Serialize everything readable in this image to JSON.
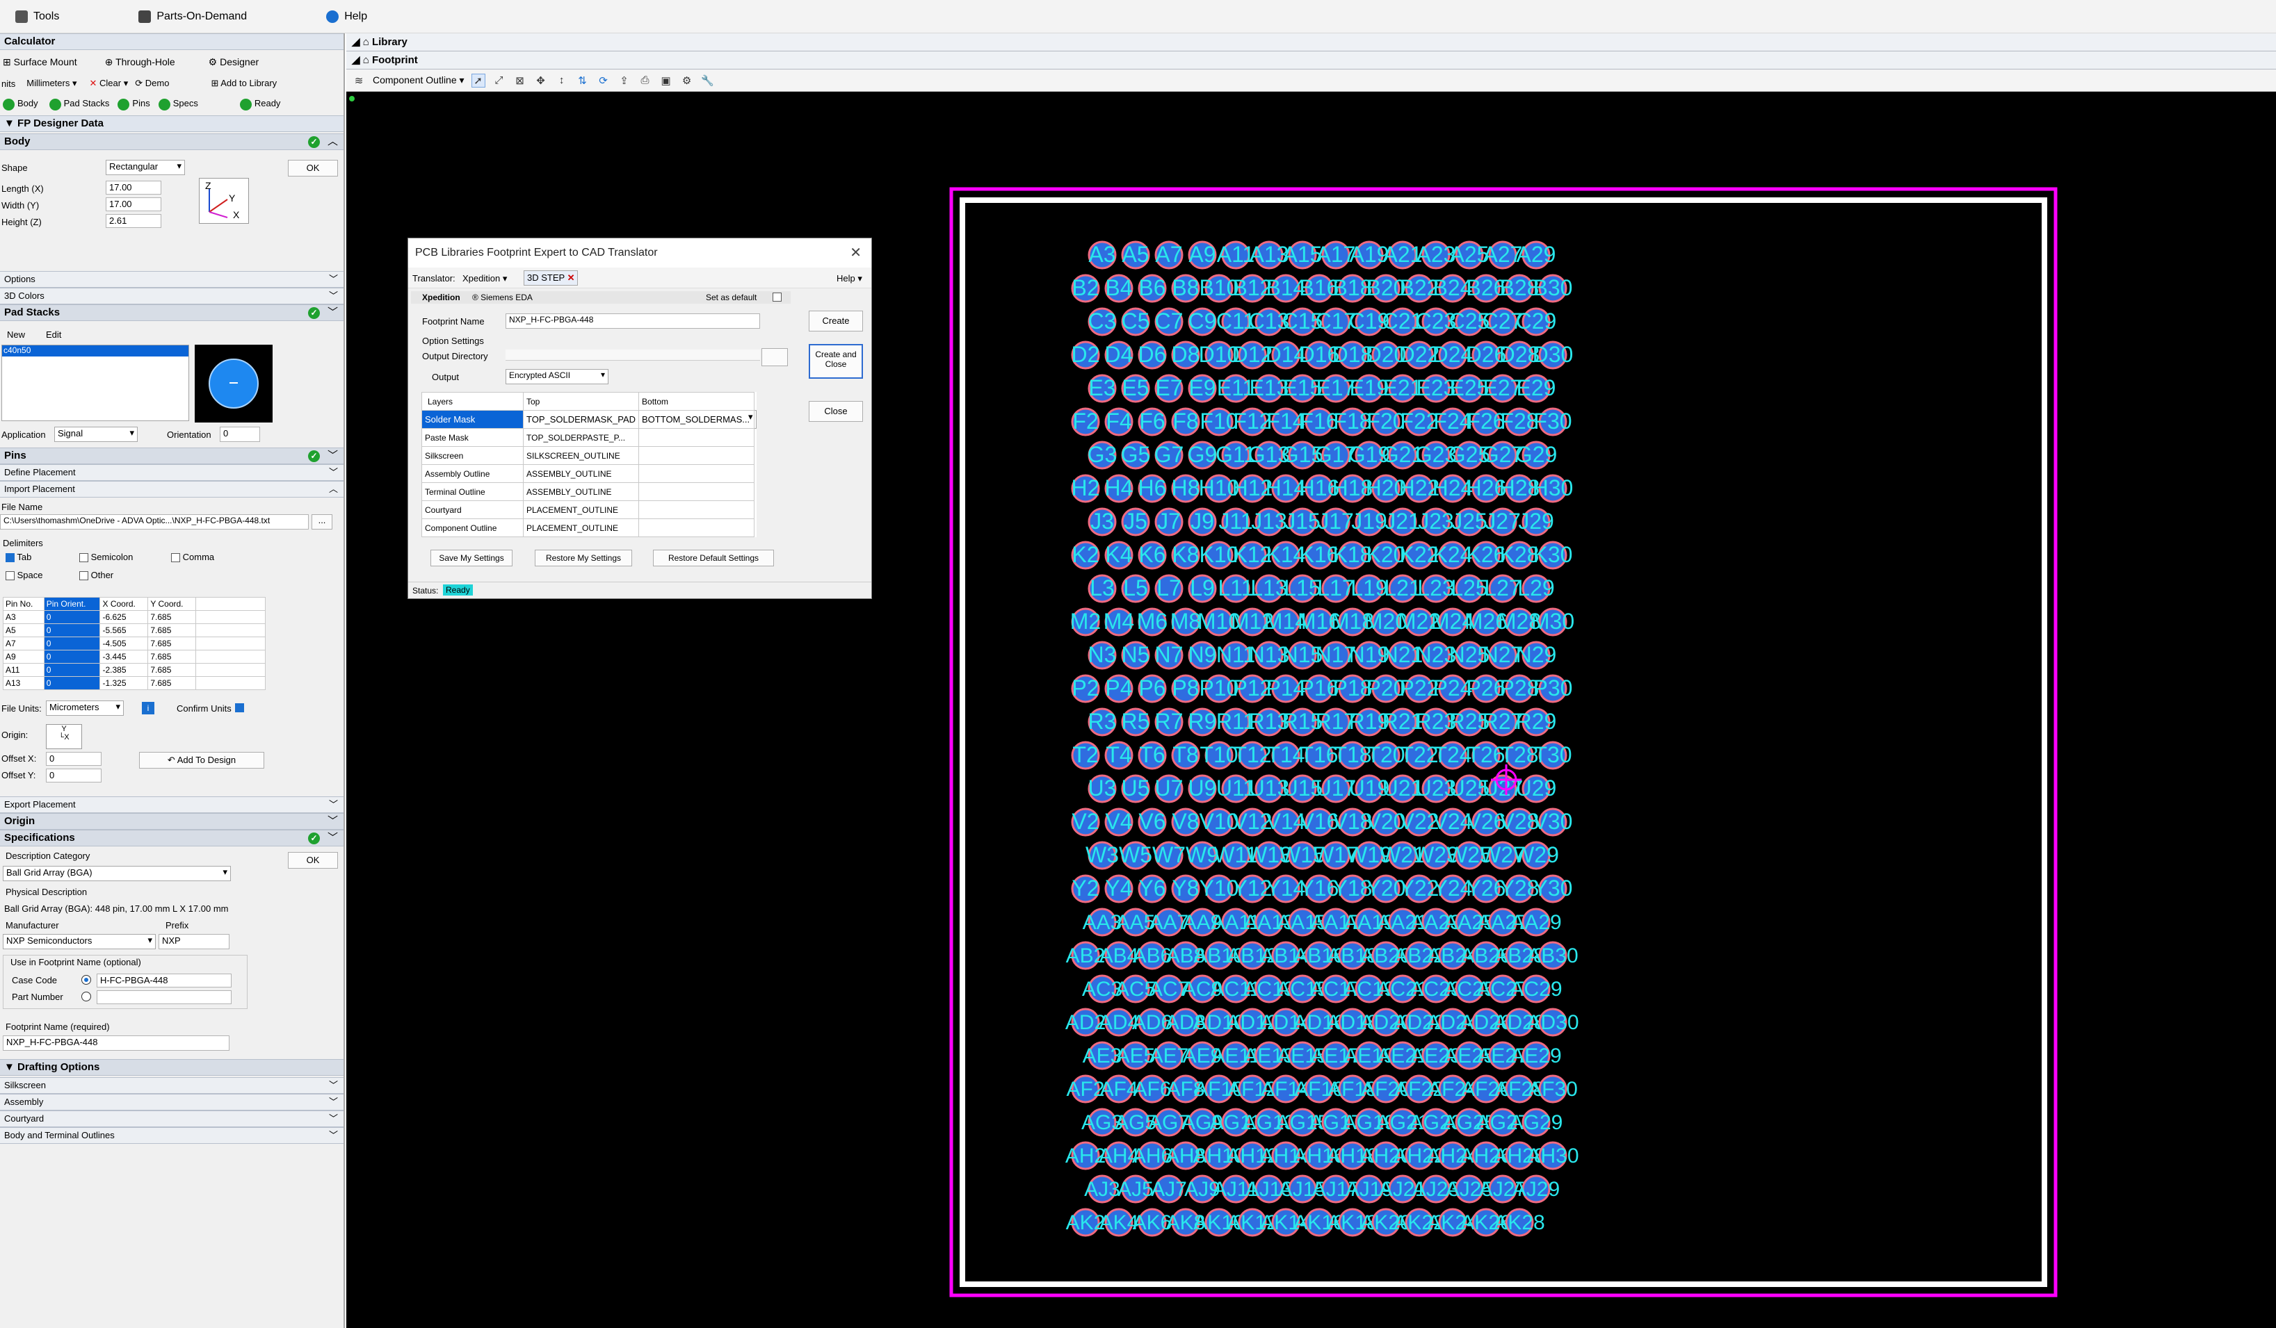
{
  "menubar": {
    "tools": "Tools",
    "parts": "Parts-On-Demand",
    "help": "Help"
  },
  "left": {
    "calculator": "Calculator",
    "surface_mount": "Surface Mount",
    "through_hole": "Through-Hole",
    "designer": "Designer",
    "units_label": "nits",
    "units_value": "Millimeters",
    "clear": "Clear",
    "demo": "Demo",
    "add_to_library": "Add to Library",
    "status": [
      "Body",
      "Pad Stacks",
      "Pins",
      "Specs"
    ],
    "ready": "Ready",
    "fp_designer_data": "FP Designer Data",
    "body": "Body",
    "shape_label": "Shape",
    "shape_value": "Rectangular",
    "ok": "OK",
    "length_label": "Length (X)",
    "length": "17.00",
    "width_label": "Width (Y)",
    "width": "17.00",
    "height_label": "Height (Z)",
    "height": "2.61",
    "axis_z": "Z",
    "axis_y": "Y",
    "axis_x": "X",
    "options": "Options",
    "colors3d": "3D Colors",
    "pad_stacks": "Pad Stacks",
    "new": "New",
    "edit": "Edit",
    "pad_item": "c40n50",
    "application_label": "Application",
    "application_value": "Signal",
    "orientation_label": "Orientation",
    "orientation_value": "0",
    "pins": "Pins",
    "define_placement": "Define Placement",
    "import_placement": "Import Placement",
    "file_name_label": "File Name",
    "file_name": "C:\\Users\\thomashm\\OneDrive - ADVA Optic...\\NXP_H-FC-PBGA-448.txt",
    "dots": "...",
    "delimiters": "Delimiters",
    "tab": "Tab",
    "semicolon": "Semicolon",
    "comma": "Comma",
    "space": "Space",
    "other": "Other",
    "pin_headers": [
      "Pin No.",
      "Pin Orient.",
      "X Coord.",
      "Y Coord."
    ],
    "pin_rows": [
      [
        "A3",
        "0",
        "-6.625",
        "7.685"
      ],
      [
        "A5",
        "0",
        "-5.565",
        "7.685"
      ],
      [
        "A7",
        "0",
        "-4.505",
        "7.685"
      ],
      [
        "A9",
        "0",
        "-3.445",
        "7.685"
      ],
      [
        "A11",
        "0",
        "-2.385",
        "7.685"
      ],
      [
        "A13",
        "0",
        "-1.325",
        "7.685"
      ]
    ],
    "file_units_label": "File Units:",
    "file_units_value": "Micrometers",
    "confirm_units": "Confirm Units",
    "origin_label": "Origin:",
    "offset_x_label": "Offset X:",
    "offset_x": "0",
    "offset_y_label": "Offset Y:",
    "offset_y": "0",
    "add_to_design": "Add To Design",
    "export_placement": "Export Placement",
    "origin": "Origin",
    "specifications": "Specifications",
    "desc_cat_label": "Description Category",
    "desc_cat_value": "Ball Grid Array (BGA)",
    "phys_desc_label": "Physical Description",
    "phys_desc": "Ball Grid Array (BGA): 448 pin, 17.00 mm L X 17.00 mm W",
    "manufacturer_label": "Manufacturer",
    "manufacturer_value": "NXP Semiconductors",
    "prefix_label": "Prefix",
    "prefix_value": "NXP",
    "use_in_name": "Use in Footprint Name (optional)",
    "case_code_label": "Case Code",
    "case_code": "H-FC-PBGA-448",
    "part_number_label": "Part Number",
    "fp_name_label": "Footprint Name (required)",
    "fp_name": "NXP_H-FC-PBGA-448",
    "drafting": "Drafting Options",
    "silkscreen": "Silkscreen",
    "assembly": "Assembly",
    "courtyard": "Courtyard",
    "body_terminal": "Body and Terminal Outlines"
  },
  "right": {
    "library": "Library",
    "footprint": "Footprint",
    "view_mode": "Component Outline"
  },
  "dialog": {
    "title": "PCB Libraries Footprint Expert to CAD Translator",
    "translator_label": "Translator:",
    "translator_value": "Xpedition",
    "tag": "3D STEP",
    "help": "Help",
    "xpedition": "Xpedition",
    "siemens": "® Siemens EDA",
    "set_default": "Set as default",
    "fp_name_label": "Footprint Name",
    "fp_name": "NXP_H-FC-PBGA-448",
    "option_settings": "Option Settings",
    "output_dir": "Output Directory",
    "output_label": "Output",
    "output_value": "Encrypted ASCII",
    "headers": [
      "Layers",
      "Top",
      "Bottom"
    ],
    "rows": [
      [
        "Solder Mask",
        "TOP_SOLDERMASK_PAD",
        "BOTTOM_SOLDERMAS..."
      ],
      [
        "Paste Mask",
        "TOP_SOLDERPASTE_P...",
        ""
      ],
      [
        "Silkscreen",
        "SILKSCREEN_OUTLINE",
        ""
      ],
      [
        "Assembly Outline",
        "ASSEMBLY_OUTLINE",
        ""
      ],
      [
        "Terminal Outline",
        "ASSEMBLY_OUTLINE",
        ""
      ],
      [
        "Courtyard",
        "PLACEMENT_OUTLINE",
        ""
      ],
      [
        "Component Outline",
        "PLACEMENT_OUTLINE",
        ""
      ]
    ],
    "save": "Save My Settings",
    "restore": "Restore My Settings",
    "restore_default": "Restore Default Settings",
    "create": "Create",
    "create_close": "Create and Close",
    "close": "Close",
    "status_label": "Status:",
    "status": "Ready"
  },
  "colors": {
    "pad_fill": "#2f6de0",
    "pad_ring": "#f06a80",
    "label": "#29e7ec",
    "outline_magenta": "#ff00ff",
    "outline_white": "#ffffff",
    "green": "#1fa12f",
    "selected": "#0a64d6"
  },
  "bga": {
    "odd_rows": [
      "A",
      "C",
      "E",
      "G",
      "J",
      "L",
      "N",
      "R",
      "U",
      "W",
      "AA",
      "AC",
      "AE",
      "AG",
      "AJ"
    ],
    "even_rows": [
      "B",
      "D",
      "F",
      "H",
      "K",
      "M",
      "P",
      "T",
      "V",
      "Y",
      "AB",
      "AD",
      "AF",
      "AH",
      "AK"
    ],
    "odd_cols": [
      3,
      5,
      7,
      9,
      11,
      13,
      15,
      17,
      19,
      21,
      23,
      25,
      27,
      29
    ],
    "even_cols": [
      2,
      4,
      6,
      8,
      10,
      12,
      14,
      16,
      18,
      20,
      22,
      24,
      26,
      28,
      30
    ],
    "last_row_max_col": 28
  }
}
